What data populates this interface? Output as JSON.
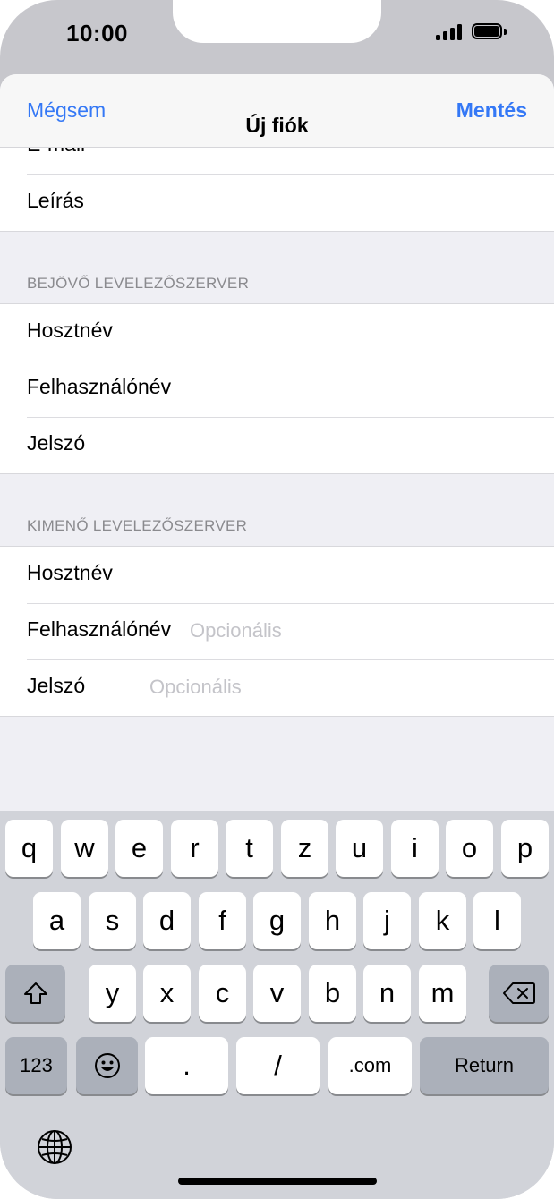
{
  "status_bar": {
    "time": "10:00",
    "signal_icon": "cellular-signal-icon",
    "battery_icon": "battery-icon"
  },
  "navbar": {
    "cancel": "Mégsem",
    "title": "Új fiók",
    "save": "Mentés"
  },
  "top_group": {
    "rows": [
      "E-mail",
      "Leírás"
    ]
  },
  "incoming": {
    "header": "BEJÖVŐ LEVELEZŐSZERVER",
    "rows": [
      "Hosztnév",
      "Felhasználónév",
      "Jelszó"
    ]
  },
  "outgoing": {
    "header": "KIMENŐ LEVELEZŐSZERVER",
    "rows": [
      {
        "label": "Hosztnév",
        "placeholder": ""
      },
      {
        "label": "Felhasználónév",
        "placeholder": "Opcionális"
      },
      {
        "label": "Jelszó",
        "placeholder": "Opcionális"
      }
    ]
  },
  "keyboard": {
    "row1": [
      "q",
      "w",
      "e",
      "r",
      "t",
      "z",
      "u",
      "i",
      "o",
      "p"
    ],
    "row2": [
      "a",
      "s",
      "d",
      "f",
      "g",
      "h",
      "j",
      "k",
      "l"
    ],
    "row3": [
      "y",
      "x",
      "c",
      "v",
      "b",
      "n",
      "m"
    ],
    "numbers": "123",
    "dot": ".",
    "slash": "/",
    "dotcom": ".com",
    "return": "Return",
    "icons": {
      "shift": "shift-icon",
      "backspace": "backspace-icon",
      "emoji": "emoji-icon",
      "globe": "globe-icon"
    }
  }
}
